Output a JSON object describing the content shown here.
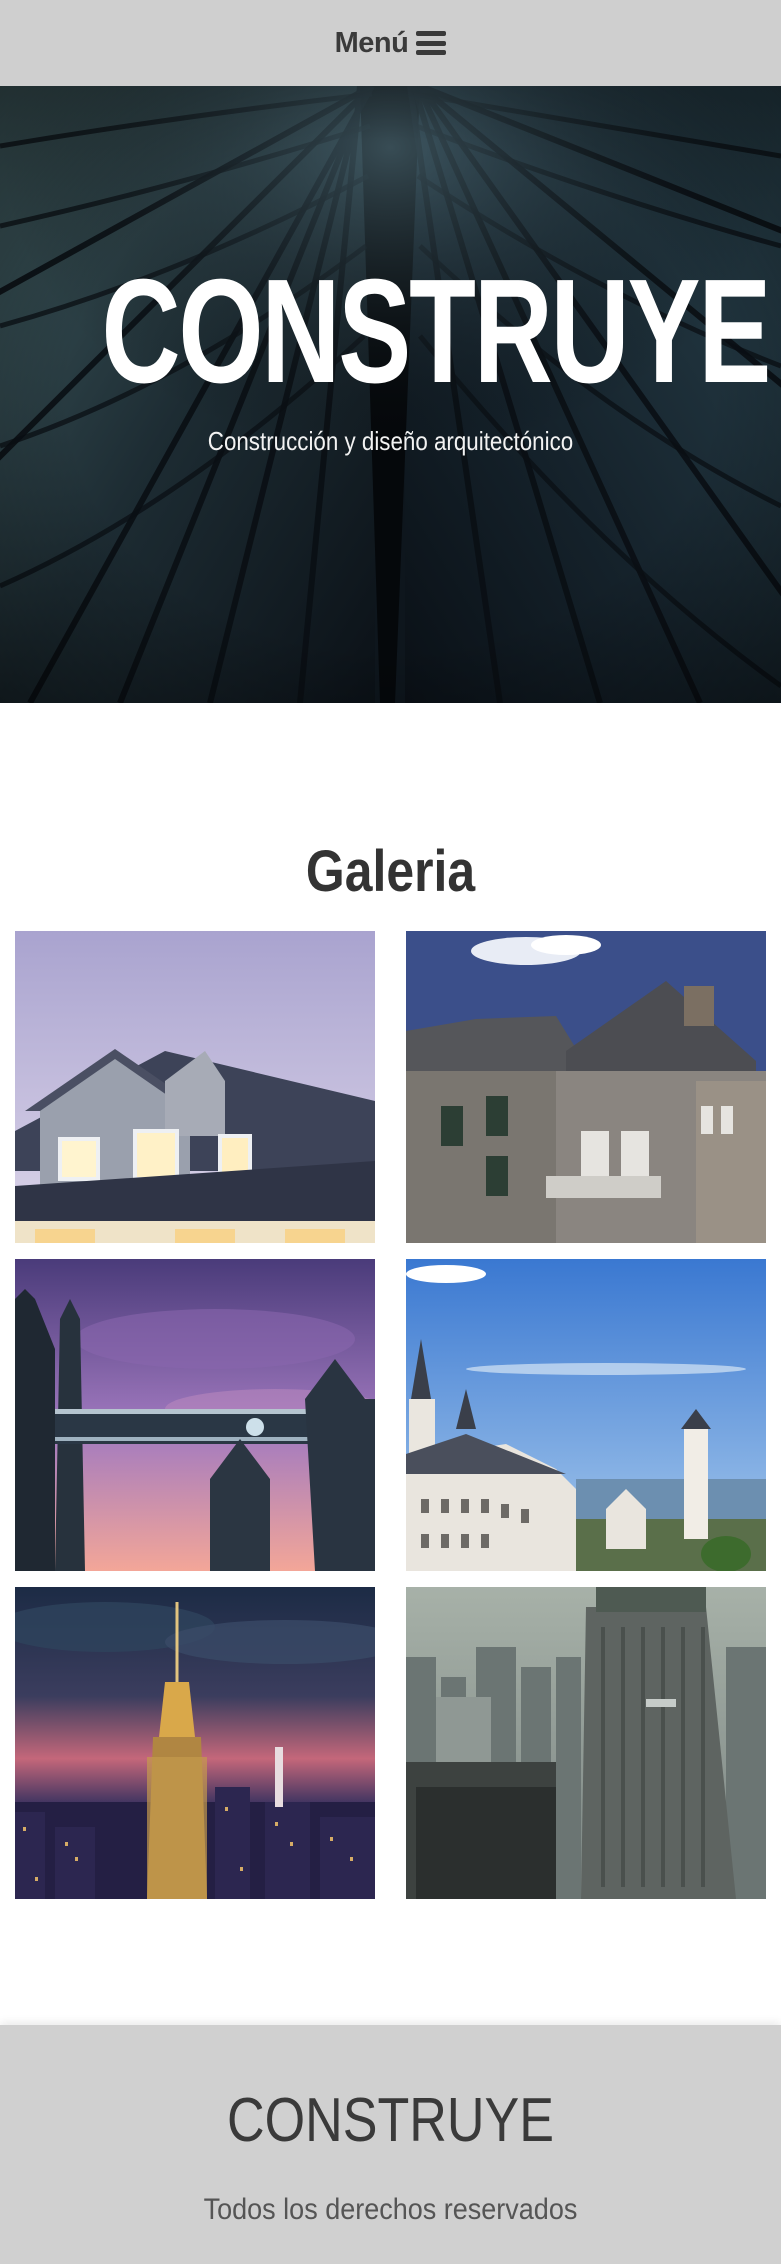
{
  "nav": {
    "menu_label": "Menú",
    "menu_icon": "hamburger-icon"
  },
  "hero": {
    "title": "CONSTRUYE",
    "subtitle": "Construcción y diseño arquitectónico",
    "background": "glass-skyscraper-photo"
  },
  "gallery": {
    "title": "Galeria",
    "images": [
      {
        "subject": "house-with-dormers-dusk"
      },
      {
        "subject": "stone-cottage"
      },
      {
        "subject": "tower-bridge-sunset"
      },
      {
        "subject": "neuschwanstein-castle"
      },
      {
        "subject": "empire-state-building-night"
      },
      {
        "subject": "city-skyscraper-aerial"
      }
    ]
  },
  "footer": {
    "brand": "CONSTRUYE",
    "copyright": "Todos los derechos reservados"
  },
  "colors": {
    "topbar_bg": "#cfcfcf",
    "footer_bg": "#d0d0d0",
    "text_dark": "#333333",
    "hero_bg": "#0d141c"
  }
}
